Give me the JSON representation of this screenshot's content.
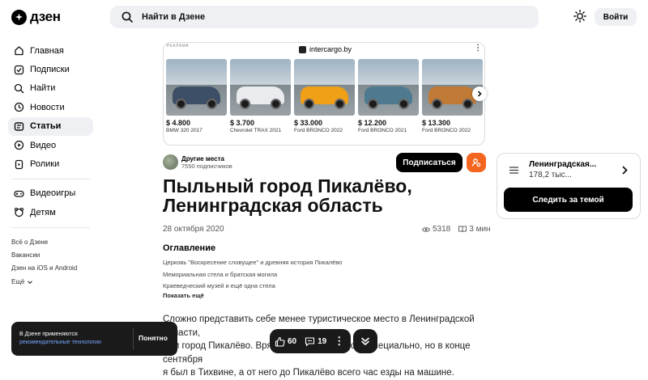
{
  "header": {
    "logo_text": "дзен",
    "search_placeholder": "Найти в Дзене",
    "login_label": "Войти"
  },
  "sidebar": {
    "items": [
      {
        "label": "Главная",
        "icon": "home-icon"
      },
      {
        "label": "Подписки",
        "icon": "subscriptions-icon"
      },
      {
        "label": "Найти",
        "icon": "search-icon"
      },
      {
        "label": "Новости",
        "icon": "news-icon"
      },
      {
        "label": "Статьи",
        "icon": "articles-icon",
        "active": true
      },
      {
        "label": "Видео",
        "icon": "video-icon"
      },
      {
        "label": "Ролики",
        "icon": "shorts-icon"
      }
    ],
    "items2": [
      {
        "label": "Видеоигры",
        "icon": "gamepad-icon"
      },
      {
        "label": "Детям",
        "icon": "kids-icon"
      }
    ],
    "footer": [
      "Всё о Дзене",
      "Вакансии",
      "Дзен на iOS и Android",
      "Ещё"
    ]
  },
  "ad": {
    "tag": "РЕКЛАМА",
    "source": "intercargo.by",
    "cards": [
      {
        "price": "$ 4.800",
        "model": "BMW 320 2017",
        "color": "#3d4f66"
      },
      {
        "price": "$ 3.700",
        "model": "Chevrolet TRAX 2021",
        "color": "#e9ebee"
      },
      {
        "price": "$ 33.000",
        "model": "Ford BRONCO 2022",
        "color": "#f0a017"
      },
      {
        "price": "$ 12.200",
        "model": "Ford BRONCO 2021",
        "color": "#4e7a8f"
      },
      {
        "price": "$ 13.300",
        "model": "Ford BRONCO 2022",
        "color": "#c07a35"
      }
    ]
  },
  "article": {
    "author": "Другие места",
    "subscribers": "7550 подписчиков",
    "subscribe_label": "Подписаться",
    "title": "Пыльный город Пикалёво, Ленинградская область",
    "date": "28 октября 2020",
    "views": "5318",
    "read_time": "3 мин",
    "toc_title": "Оглавление",
    "toc": [
      "Церковь \"Воскресение словущее\" и древняя история Пикалёво",
      "Мемориальная стела и братская могила",
      "Краеведческий музей и ещё одна стела"
    ],
    "toc_more": "Показать ещё",
    "body_lines": [
      "Сложно представить себе менее туристическое место в Ленинградской области,",
      "чем город Пикалёво. Вряд ли кто-то едет сюда специально, но в конце сентября",
      "я был в Тихвине, а от него до Пикалёво всего час езды на машине."
    ]
  },
  "topic": {
    "title": "Ленинградская...",
    "count": "178,2 тыс...",
    "follow_label": "Следить за темой"
  },
  "cookie": {
    "line1": "В Дзене применяются",
    "link": "рекомендательные технологии",
    "ok_label": "Понятно"
  },
  "actions": {
    "likes": "60",
    "comments": "19"
  }
}
